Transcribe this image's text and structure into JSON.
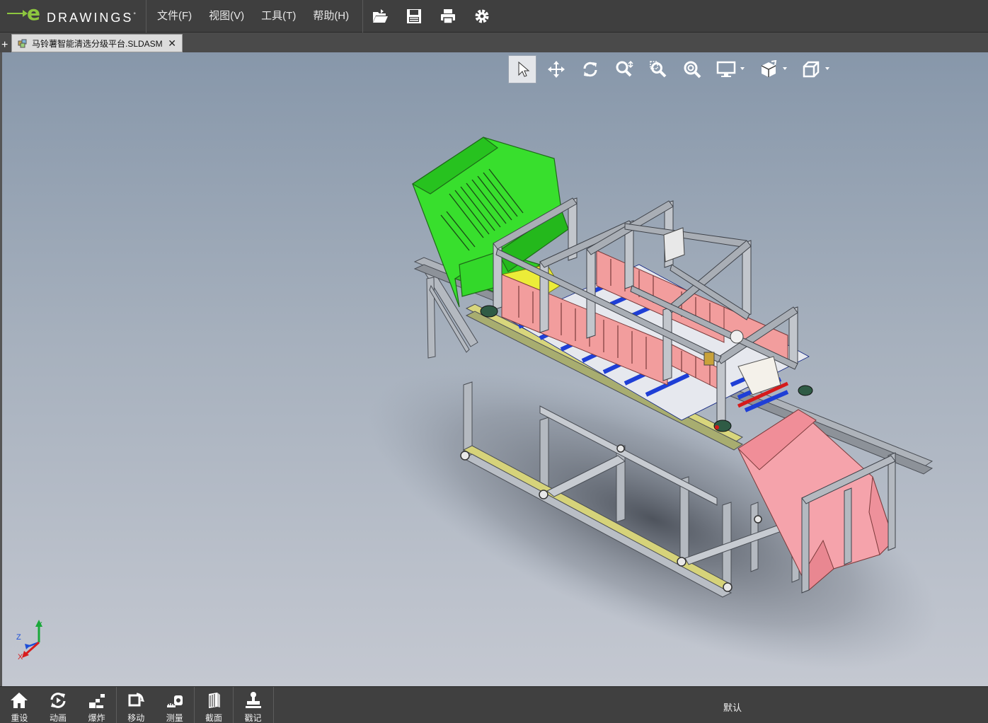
{
  "app": {
    "logo_letter": "e",
    "logo_word": "DRAWINGS",
    "logo_mark": "°"
  },
  "menu": [
    {
      "label": "文件(F)"
    },
    {
      "label": "视图(V)"
    },
    {
      "label": "工具(T)"
    },
    {
      "label": "帮助(H)"
    }
  ],
  "file_toolbar": [
    "open-folder-icon",
    "save-icon",
    "print-icon",
    "settings-gear-icon"
  ],
  "tabs": {
    "add": "+",
    "document": "马铃薯智能清选分级平台.SLDASM",
    "close": "✕"
  },
  "view_toolbar": [
    "select-arrow-icon",
    "pan-icon",
    "rotate-icon",
    "zoom-icon",
    "zoom-area-icon",
    "zoom-fit-icon",
    "display-mode-icon",
    "view-orientation-icon",
    "standard-views-icon"
  ],
  "triad": {
    "y": "Y",
    "z": "Z",
    "x": "X"
  },
  "bottom_toolbar": {
    "reset": "重设",
    "animate": "动画",
    "explode": "爆炸",
    "move": "移动",
    "measure": "测量",
    "section": "截面",
    "markup": "戳记"
  },
  "status": {
    "configuration": "默认"
  },
  "colors": {
    "hopper": "#33dd2a",
    "panels": "#f29a9a",
    "rollers": "#1f3fd6",
    "frame": "#9aa0a8",
    "chute": "#f2a0a8",
    "accent_yellow": "#e8e83a"
  }
}
